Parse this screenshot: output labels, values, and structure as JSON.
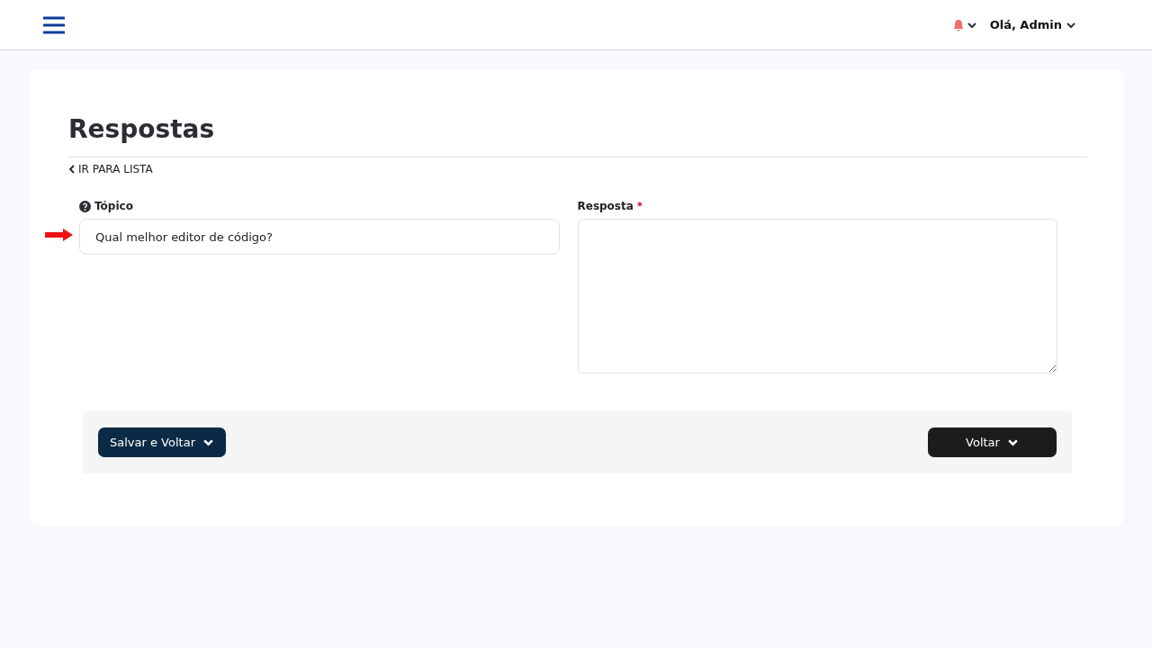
{
  "header": {
    "greeting": "Olá, Admin"
  },
  "page": {
    "title": "Respostas",
    "back_link": "IR PARA LISTA"
  },
  "fields": [
    {
      "kind": "input",
      "label": "Tópico",
      "help": true,
      "value": "Qual melhor editor de código?",
      "highlighted": true
    },
    {
      "kind": "textarea",
      "label": "Resposta",
      "required_mark": "*"
    }
  ],
  "actions": [
    {
      "label": "Salvar e Voltar",
      "color": "#0b2a45"
    },
    {
      "label": "Voltar",
      "color": "#1c1c1c"
    }
  ]
}
